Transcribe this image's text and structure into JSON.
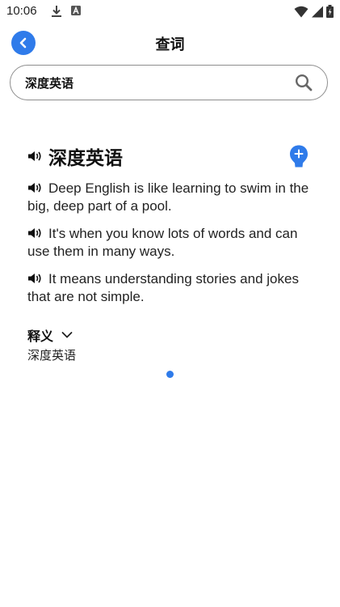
{
  "status_bar": {
    "time": "10:06",
    "icons": [
      "download-icon",
      "a-box-icon",
      "wifi-icon",
      "signal-icon",
      "battery-icon"
    ]
  },
  "header": {
    "title": "查词",
    "back_icon": "chevron-left-icon"
  },
  "search": {
    "value": "深度英语",
    "icon": "search-icon"
  },
  "entry": {
    "word": "深度英语",
    "add_icon": "add-to-wordbook-icon",
    "sentences": [
      "Deep English is like learning to swim in the big, deep part of a pool.",
      "It's when you know lots of words and can use them in many ways.",
      "It means understanding stories and jokes that are not simple."
    ],
    "definition_label": "释义",
    "definition_text": "深度英语"
  },
  "colors": {
    "accent": "#2f7bea",
    "border": "#8e8e8e",
    "text": "#111111"
  }
}
